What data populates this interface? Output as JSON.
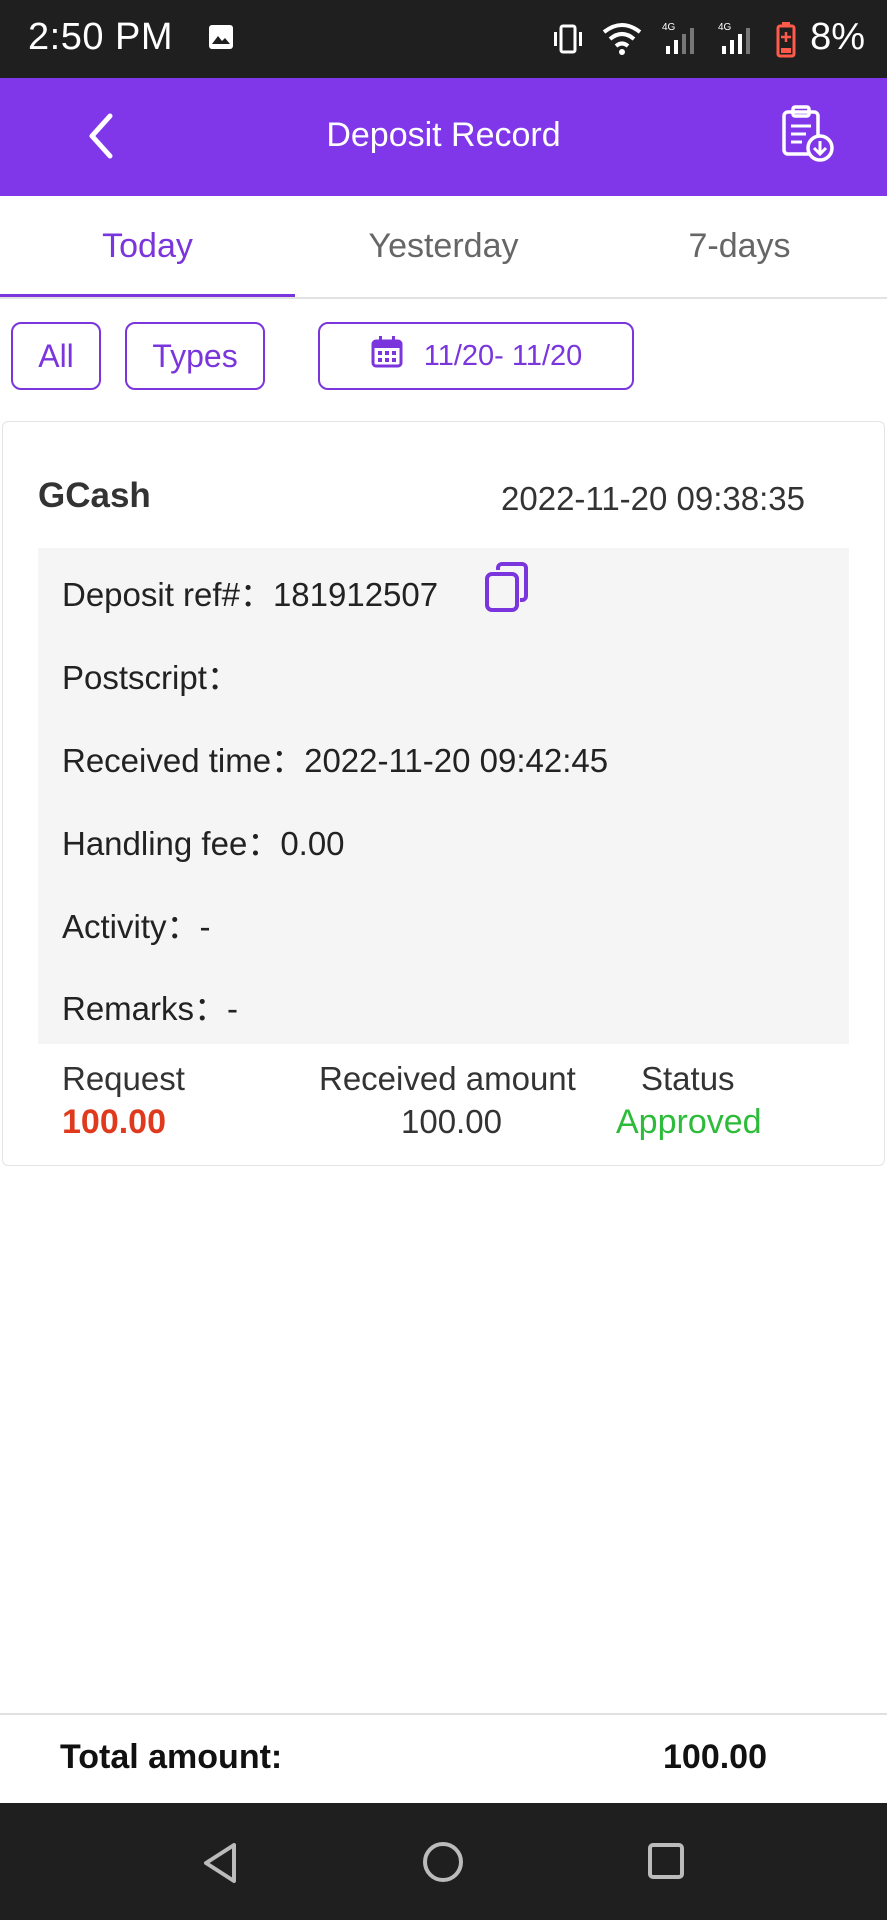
{
  "status_bar": {
    "time": "2:50 PM",
    "battery": "8%"
  },
  "header": {
    "title": "Deposit Record"
  },
  "tabs": [
    {
      "label": "Today",
      "active": true
    },
    {
      "label": "Yesterday",
      "active": false
    },
    {
      "label": "7-days",
      "active": false
    }
  ],
  "filters": {
    "all_label": "All",
    "types_label": "Types",
    "date_range": "11/20- 11/20"
  },
  "record": {
    "method": "GCash",
    "datetime": "2022-11-20 09:38:35",
    "deposit_ref_label": "Deposit ref#：",
    "deposit_ref_value": "181912507",
    "postscript_label": "Postscript：",
    "received_time_label": "Received time：",
    "received_time_value": "2022-11-20 09:42:45",
    "handling_fee_label": "Handling fee：",
    "handling_fee_value": "0.00",
    "activity_label": "Activity：",
    "activity_value": "-",
    "remarks_label": "Remarks：",
    "remarks_value": "-",
    "request_label": "Request",
    "request_value": "100.00",
    "received_amount_label": "Received amount",
    "received_amount_value": "100.00",
    "status_label": "Status",
    "status_value": "Approved"
  },
  "footer": {
    "total_label": "Total amount:",
    "total_value": "100.00"
  },
  "colors": {
    "brand": "#8037ea",
    "accent": "#7a35dc",
    "request_red": "#e03a1e",
    "approved_green": "#2dbb3a"
  }
}
